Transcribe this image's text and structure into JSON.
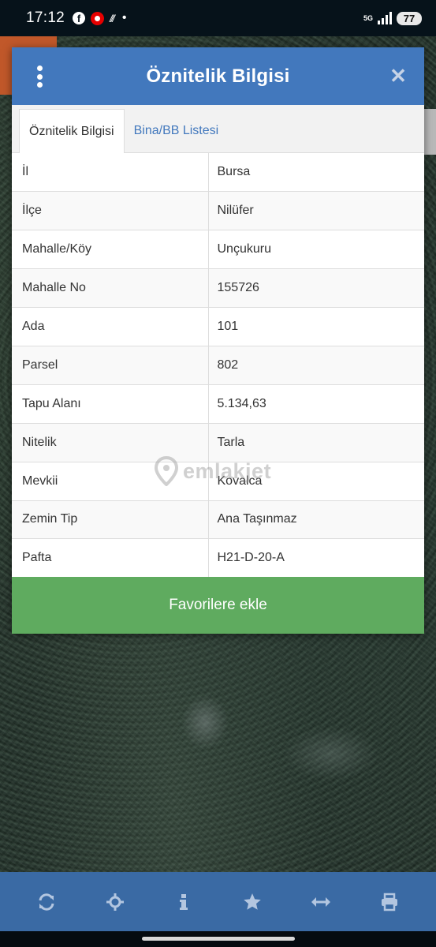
{
  "status_bar": {
    "time": "17:12",
    "network": "5G",
    "battery": "77"
  },
  "dialog": {
    "title": "Öznitelik Bilgisi",
    "tabs": [
      {
        "label": "Öznitelik Bilgisi",
        "active": true
      },
      {
        "label": "Bina/BB Listesi",
        "active": false
      }
    ],
    "rows": [
      {
        "label": "İl",
        "value": "Bursa"
      },
      {
        "label": "İlçe",
        "value": "Nilüfer"
      },
      {
        "label": "Mahalle/Köy",
        "value": "Unçukuru"
      },
      {
        "label": "Mahalle No",
        "value": "155726"
      },
      {
        "label": "Ada",
        "value": "101"
      },
      {
        "label": "Parsel",
        "value": "802"
      },
      {
        "label": "Tapu Alanı",
        "value": "5.134,63"
      },
      {
        "label": "Nitelik",
        "value": "Tarla"
      },
      {
        "label": "Mevkii",
        "value": "Kovalca"
      },
      {
        "label": "Zemin Tip",
        "value": "Ana Taşınmaz"
      },
      {
        "label": "Pafta",
        "value": "H21-D-20-A"
      }
    ],
    "favorite_button": "Favorilere ekle"
  },
  "watermark": "emlakjet",
  "toolbar": {
    "icons": [
      "refresh-icon",
      "locate-icon",
      "info-icon",
      "star-icon",
      "measure-icon",
      "print-icon"
    ]
  },
  "colors": {
    "header": "#4278bd",
    "favorite": "#5fab5f",
    "toolbar": "#3a6aa4"
  }
}
